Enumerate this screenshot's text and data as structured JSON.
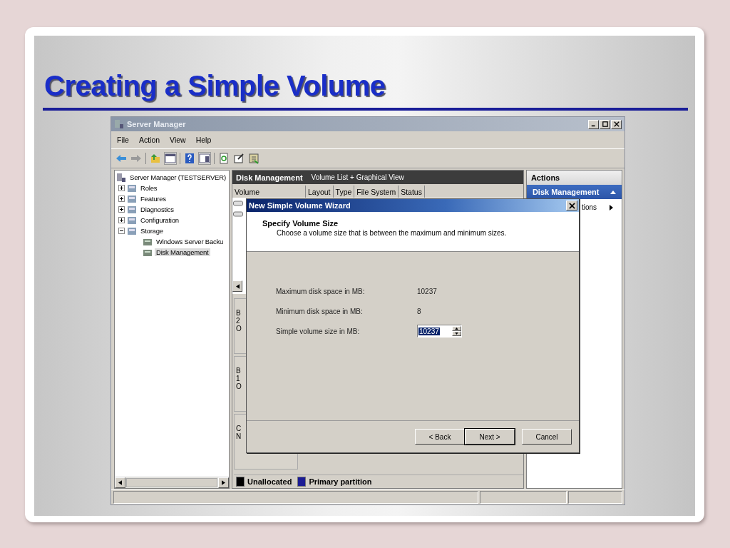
{
  "slide": {
    "title": "Creating a Simple Volume"
  },
  "window": {
    "title": "Server Manager"
  },
  "menu": [
    "File",
    "Action",
    "View",
    "Help"
  ],
  "tree": [
    {
      "label": "Server Manager (TESTSERVER)",
      "selected": false,
      "children": [
        {
          "label": "Roles",
          "expanded": false,
          "selected": false
        },
        {
          "label": "Features",
          "expanded": false,
          "selected": false
        },
        {
          "label": "Diagnostics",
          "expanded": false,
          "selected": false
        },
        {
          "label": "Configuration",
          "expanded": false,
          "selected": false
        },
        {
          "label": "Storage",
          "expanded": true,
          "selected": false,
          "children": [
            {
              "label": "Windows Server Backu",
              "selected": false
            },
            {
              "label": "Disk Management",
              "selected": true
            }
          ]
        }
      ]
    }
  ],
  "center": {
    "title": "Disk Management",
    "subtitle": "Volume List + Graphical View",
    "columns": [
      "Volume",
      "Layout",
      "Type",
      "File System",
      "Status"
    ],
    "disks": [
      {
        "lines": [
          "B",
          "2",
          "O"
        ]
      },
      {
        "lines": [
          "B",
          "1",
          "O"
        ]
      },
      {
        "lines": [
          "C",
          "N"
        ]
      }
    ],
    "legend": [
      {
        "label": "Unallocated",
        "color": "#000000"
      },
      {
        "label": "Primary partition",
        "color": "#1c1c94"
      }
    ]
  },
  "actions": {
    "title": "Actions",
    "section": "Disk Management",
    "item": "tions"
  },
  "wizard": {
    "title": "New Simple Volume Wizard",
    "heading": "Specify Volume Size",
    "description": "Choose a volume size that is between the maximum and minimum sizes.",
    "fields": [
      {
        "kind": "text",
        "label": "Maximum disk space in MB:",
        "value": "10237"
      },
      {
        "kind": "text",
        "label": "Minimum disk space in MB:",
        "value": "8"
      },
      {
        "kind": "spinner",
        "label": "Simple volume size in MB:",
        "value": "10237"
      }
    ],
    "buttons": [
      {
        "label": "< Back",
        "default": false
      },
      {
        "label": "Next >",
        "default": true
      },
      {
        "label": "Cancel",
        "default": false
      }
    ]
  }
}
